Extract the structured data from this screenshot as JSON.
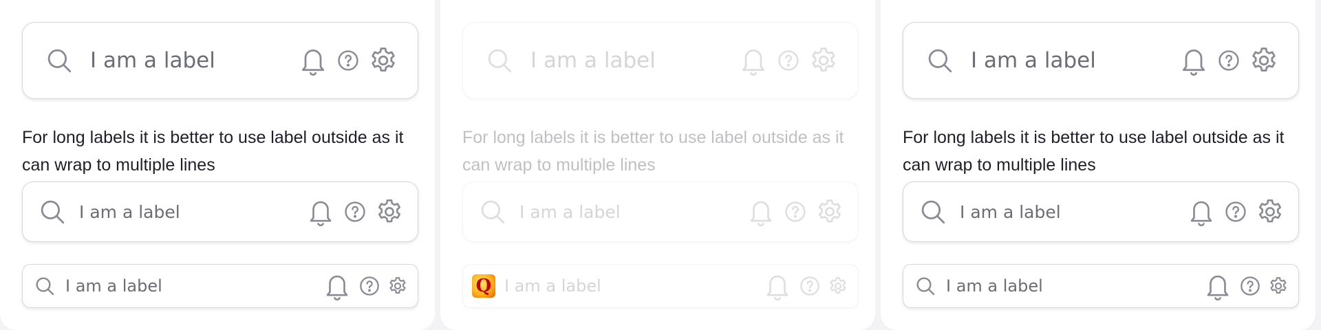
{
  "colors": {
    "icon": "#8a8a94",
    "label": "#6c6c76",
    "hint": "#1e1e2c",
    "border": "#d6d6dc",
    "panel": "#ffffff",
    "background": "#f3f3f6"
  },
  "panels": [
    {
      "state": "default",
      "large_field": {
        "label": "I am a label",
        "icons": [
          "search-icon",
          "bell-icon",
          "help-icon",
          "gear-icon"
        ]
      },
      "hint": "For long labels it is better to use label outside as it can wrap to multiple lines",
      "medium_field": {
        "label": "I am a label",
        "icons": [
          "search-icon",
          "bell-icon",
          "help-icon",
          "gear-icon"
        ]
      },
      "small_field": {
        "label": "I am a label",
        "icons": [
          "search-icon",
          "bell-icon",
          "help-icon",
          "gear-icon"
        ]
      }
    },
    {
      "state": "disabled",
      "large_field": {
        "label": "I am a label",
        "icons": [
          "search-icon",
          "bell-icon",
          "help-icon",
          "gear-icon"
        ]
      },
      "hint": "For long labels it is better to use label outside as it can wrap to multiple lines",
      "medium_field": {
        "label": "I am a label",
        "icons": [
          "search-icon",
          "bell-icon",
          "help-icon",
          "gear-icon"
        ]
      },
      "small_field": {
        "label": "I am a label",
        "icons": [
          "q-logo-icon",
          "bell-icon",
          "help-icon",
          "gear-icon"
        ]
      }
    },
    {
      "state": "default",
      "large_field": {
        "label": "I am a label",
        "icons": [
          "search-icon",
          "bell-icon",
          "help-icon",
          "gear-icon"
        ]
      },
      "hint": "For long labels it is better to use label outside as it can wrap to multiple lines",
      "medium_field": {
        "label": "I am a label",
        "icons": [
          "search-icon",
          "bell-icon",
          "help-icon",
          "gear-icon"
        ]
      },
      "small_field": {
        "label": "I am a label",
        "icons": [
          "search-icon",
          "bell-icon",
          "help-icon",
          "gear-icon"
        ]
      }
    }
  ]
}
